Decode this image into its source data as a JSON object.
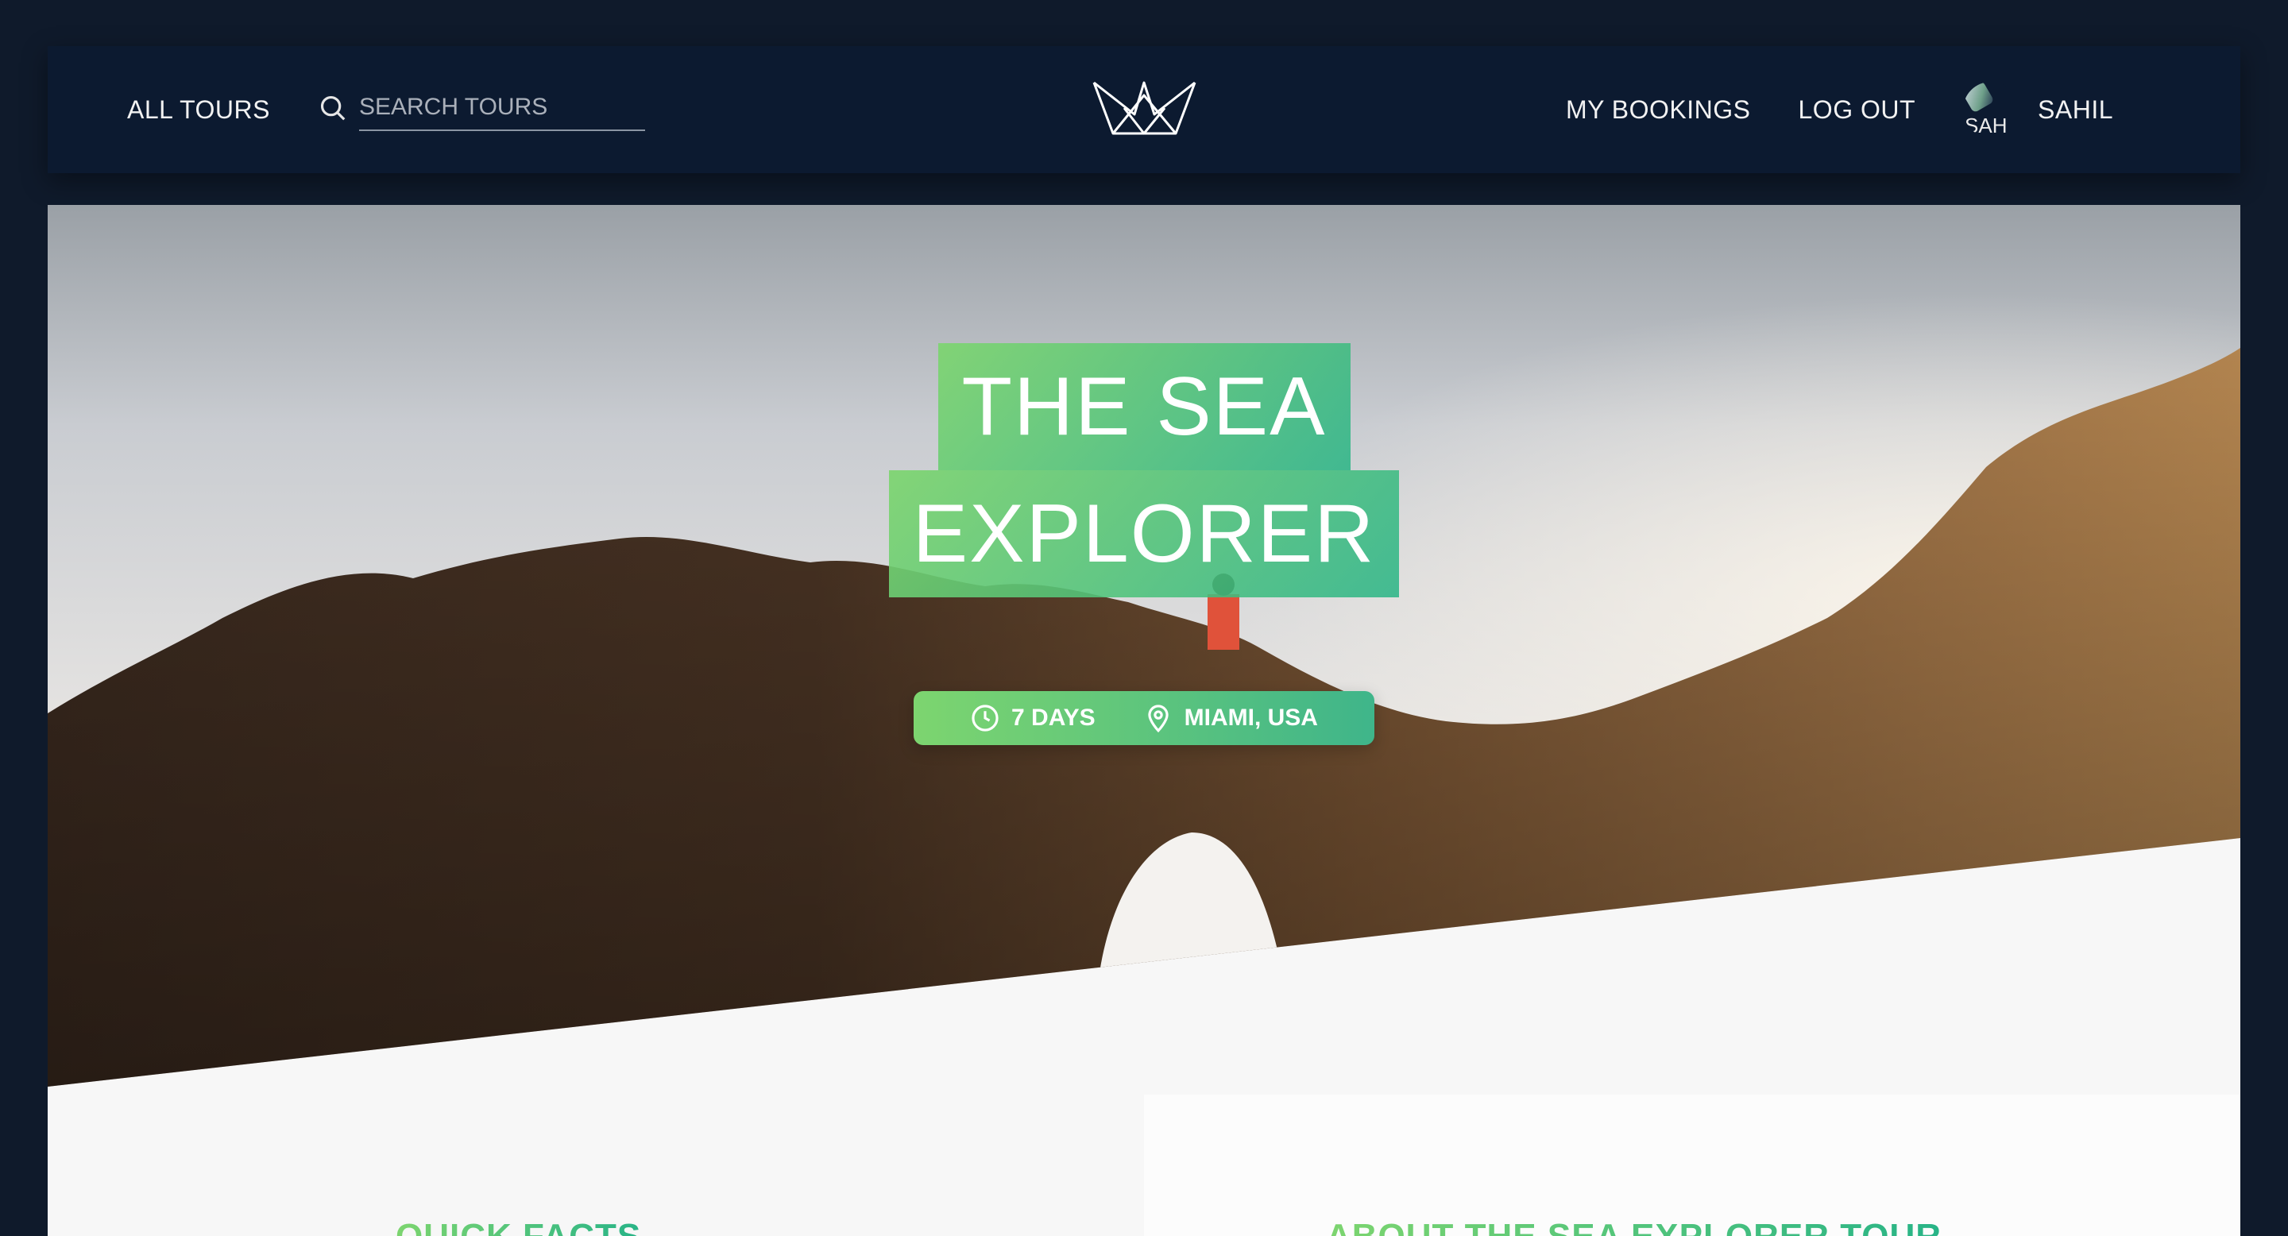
{
  "header": {
    "all_tours": "All tours",
    "search": {
      "placeholder": "SEARCH TOURS",
      "value": ""
    },
    "logo": "crown-logo",
    "my_bookings": "My bookings",
    "log_out": "Log out",
    "user": {
      "avatar_alt": "SAH",
      "name": "Sahil"
    }
  },
  "hero": {
    "title_line1": "The Sea",
    "title_line2": "Explorer",
    "duration": "7 days",
    "location": "Miami, USA",
    "icons": {
      "duration": "clock-icon",
      "location": "map-pin-icon"
    }
  },
  "sections": {
    "quick_facts": "Quick facts",
    "about": "About the sea explorer tour"
  },
  "colors": {
    "accent_start": "#7dd56f",
    "accent_end": "#28b487",
    "header_bg": "#0c1a30",
    "page_bg": "#0f1a2b"
  }
}
